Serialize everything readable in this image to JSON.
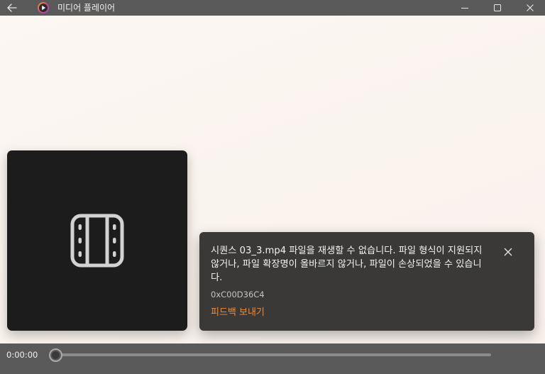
{
  "window": {
    "title": "미디어 플레이어"
  },
  "icons": {
    "back": "back-arrow-icon",
    "app": "media-player-icon",
    "minimize": "minimize-icon",
    "maximize": "maximize-icon",
    "close": "close-icon",
    "video": "film-icon",
    "toast_close": "close-icon"
  },
  "toast": {
    "message": "시퀀스 03_3.mp4 파일을 재생할 수 없습니다. 파일 형식이 지원되지 않거나, 파일 확장명이 올바르지 않거나, 파일이 손상되었을 수 있습니다.",
    "error_code": "0xC00D36C4",
    "feedback_link": "피드백 보내기"
  },
  "transport": {
    "current_time": "0:00:00",
    "progress": 0
  },
  "colors": {
    "titlebar": "#5a5a5a",
    "accent": "#f5892f",
    "toast_bg": "#3a3938",
    "thumb_bg": "#1c1c1c"
  }
}
